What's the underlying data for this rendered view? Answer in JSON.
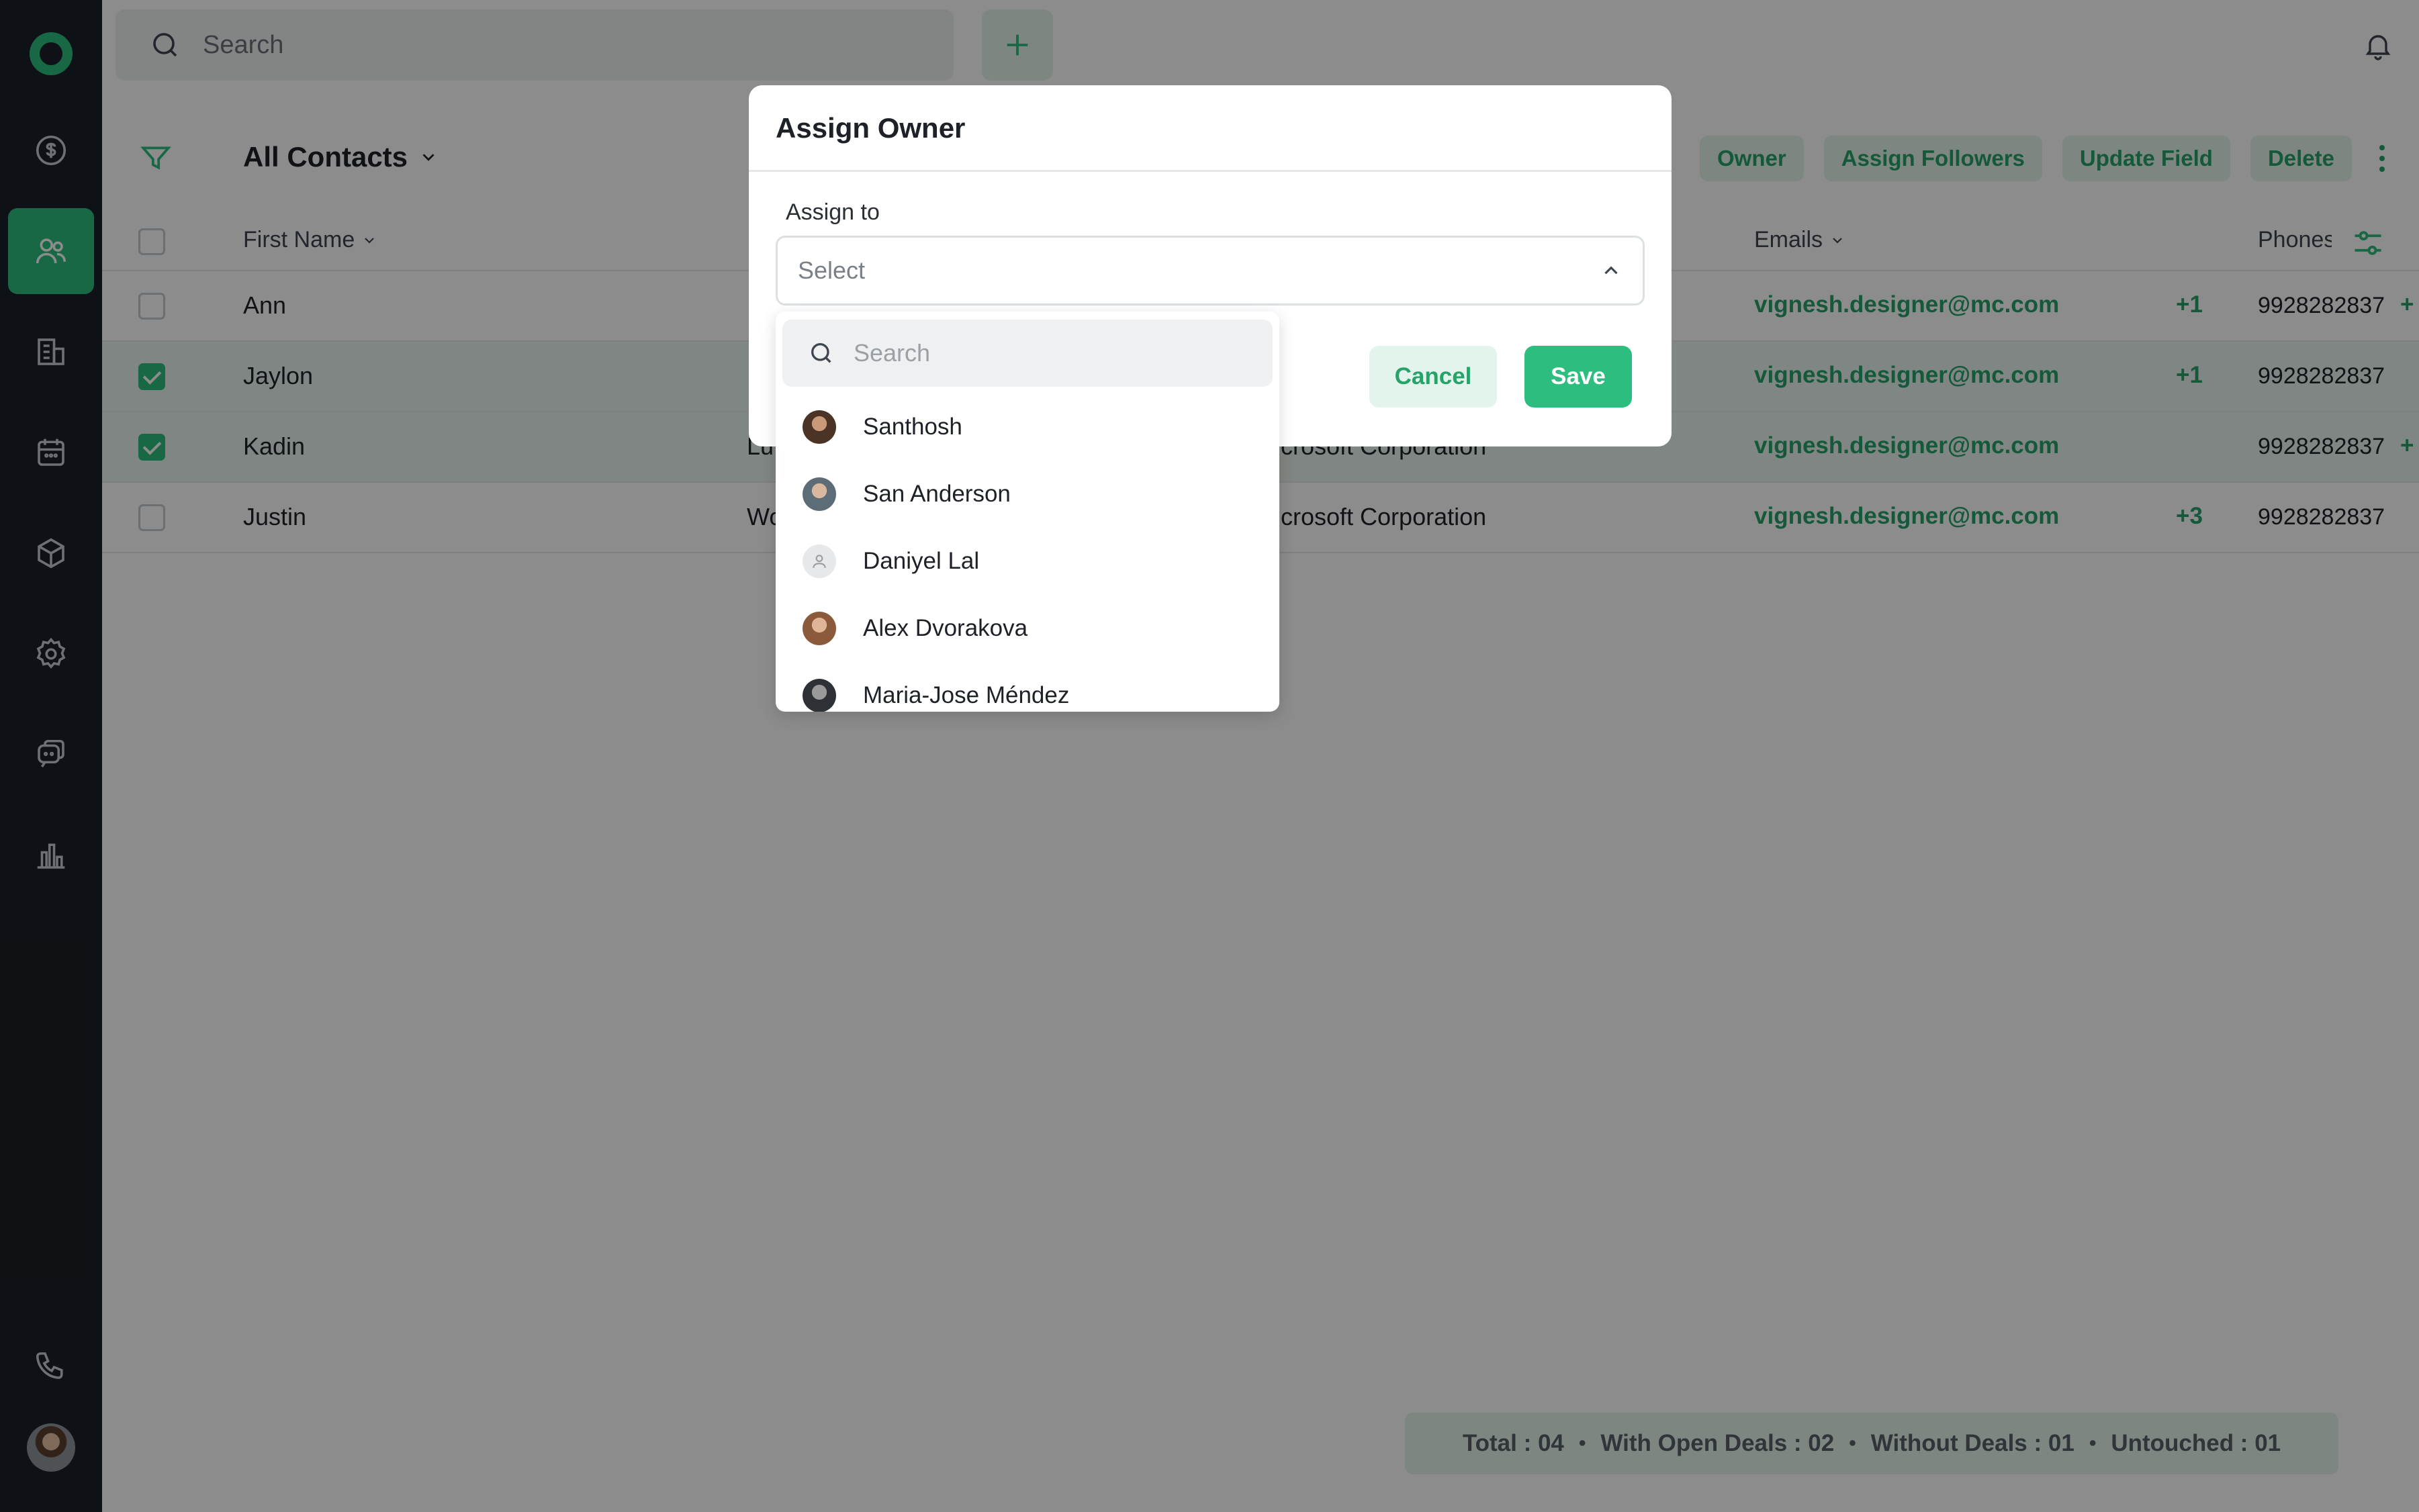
{
  "topbar": {
    "search_placeholder": "Search"
  },
  "view": {
    "title": "All Contacts"
  },
  "actions": [
    "Owner",
    "Assign Followers",
    "Update Field",
    "Delete"
  ],
  "table": {
    "headers": {
      "first_name": "First Name",
      "emails": "Emails",
      "phones": "Phones"
    },
    "rows": [
      {
        "first_name": "Ann",
        "last_name": "",
        "company": "",
        "email": "vignesh.designer@mc.com",
        "email_extra": "+1",
        "phone": "9928282837",
        "phone_extra": "+",
        "selected": false
      },
      {
        "first_name": "Jaylon",
        "last_name": "",
        "company": "",
        "email": "vignesh.designer@mc.com",
        "email_extra": "+1",
        "phone": "9928282837",
        "phone_extra": "",
        "selected": true
      },
      {
        "first_name": "Kadin",
        "last_name": "Lu",
        "company": "crosoft Corporation",
        "email": "vignesh.designer@mc.com",
        "email_extra": "",
        "phone": "9928282837",
        "phone_extra": "+",
        "selected": true
      },
      {
        "first_name": "Justin",
        "last_name": "Wo",
        "company": "crosoft Corporation",
        "email": "vignesh.designer@mc.com",
        "email_extra": "+3",
        "phone": "9928282837",
        "phone_extra": "",
        "selected": false
      }
    ]
  },
  "footer": {
    "total": "Total : 04",
    "with_open_deals": "With Open Deals : 02",
    "without_deals": "Without Deals : 01",
    "untouched": "Untouched : 01",
    "separator": "•"
  },
  "modal": {
    "title": "Assign Owner",
    "assign_label": "Assign to",
    "select_placeholder": "Select",
    "cancel_label": "Cancel",
    "save_label": "Save",
    "dropdown": {
      "search_placeholder": "Search",
      "options": [
        "Santhosh",
        "San Anderson",
        "Daniyel Lal",
        "Alex Dvorakova",
        "Maria-Jose Méndez"
      ]
    }
  },
  "colors": {
    "accent": "#2dbd7e",
    "accent_text": "#27a36a",
    "sidebar": "#1b1f27",
    "overlay": "rgba(0,0,0,0.45)"
  },
  "icons": [
    "logo-icon",
    "deals-icon",
    "contacts-icon",
    "companies-icon",
    "calendar-icon",
    "products-icon",
    "settings-icon",
    "chat-icon",
    "reports-icon",
    "phone-icon",
    "search-icon",
    "plus-icon",
    "bell-icon",
    "filter-icon",
    "chevron-down-icon",
    "chevron-up-icon",
    "kebab-icon",
    "columns-icon"
  ]
}
